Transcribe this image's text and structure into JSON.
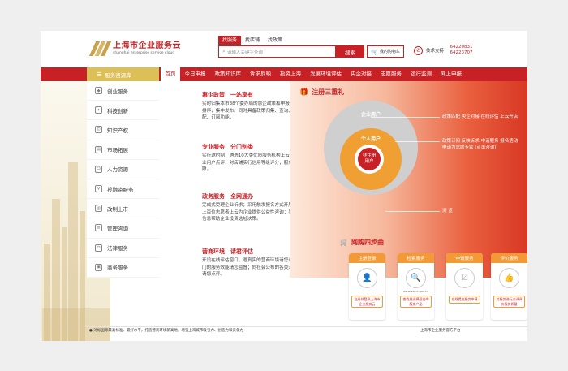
{
  "header": {
    "logo_cn": "上海市企业服务云",
    "logo_en": "shanghai enterprise service cloud",
    "search_tabs": [
      "找服务",
      "找店铺",
      "找政策"
    ],
    "search_placeholder": "请输入关键字查询",
    "search_button": "搜索",
    "cart_label": "我的购物车",
    "support_label": "技术支持：",
    "support_numbers": [
      "64220831",
      "64223707"
    ]
  },
  "nav": {
    "category_label": "服务资源库",
    "items": [
      "首页",
      "今日申报",
      "政策知识库",
      "诉求反映",
      "投资上海",
      "发展环境评估",
      "央企对接",
      "志愿服务",
      "运行监测",
      "网上申报"
    ]
  },
  "sidebar": {
    "items": [
      "创业服务",
      "科技创新",
      "知识产权",
      "市场拓展",
      "人力资源",
      "投融资服务",
      "改制上市",
      "管理咨询",
      "法律服务",
      "商务服务"
    ]
  },
  "content": {
    "blocks": [
      {
        "title": "惠企政策　一站享有",
        "text": "实时归集本市38个委办局的惠企政策和申报系统，倒计时排序，集中发布。同时具备政策归集、查询、推送、匹配、订阅功能。"
      },
      {
        "title": "专业服务　分门别类",
        "text": "实行邀约制，遴选10大类优质服务机构上云开店。根据企业用户点评，对店铺实行信用等级评分，服务质量有保障。"
      },
      {
        "title": "政务服务　全网通办",
        "text": "完成式受理企业诉求；采用触发报名方式开展央企对接；上百位志愿者上云为企业提供公益性咨询；另有各类涉企信息帮助企业投资选址决策。"
      },
      {
        "title": "营商环境　请君评估",
        "text": "开设在线评估窗口，邀真实的营商环境请您评估；政府部门的服务效能请您监督；向社会公布的各类涉企政策效果请您点评。"
      }
    ]
  },
  "register": {
    "title": "注册三重礼",
    "outer_label": "企业用户",
    "mid_label": "个人用户",
    "core_label_1": "非注册",
    "core_label_2": "用户",
    "line1": "政策匹配  央企对接  在线评估  上云开店",
    "line2": "政策订阅  反映诉求  申请服务  报名活动",
    "line3": "申请为志愿专家  (点击咨询)",
    "line4": "浏 览"
  },
  "wanggou": {
    "title": "网购四步曲",
    "steps": [
      {
        "label": "注册登录",
        "desc": "注册并登录上海市企业服务云",
        "icon": "user-login-icon"
      },
      {
        "label": "检索服务",
        "desc": "查找并选择适合的服务产品",
        "icon": "search-service-icon",
        "caption": "www.ssme.gov.cn"
      },
      {
        "label": "申请服务",
        "desc": "在线提交服务申请",
        "icon": "apply-service-icon"
      },
      {
        "label": "评价服务",
        "desc": "对服务进行点评评价服务质量",
        "icon": "thumbs-up-icon"
      }
    ]
  },
  "footer": {
    "left": "● 对标国际最高标准、最好水平，打造营商环境新高地，增强上海城市吸引力、创造力和竞争力",
    "right": "上海市企业服务官方平台"
  },
  "colors": {
    "brand_red": "#c72126",
    "gold": "#dcbf57",
    "orange": "#f39a37"
  }
}
